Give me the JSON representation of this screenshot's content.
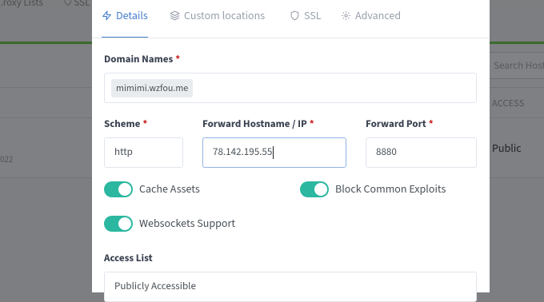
{
  "background": {
    "nav_items": [
      "...roxy Lists",
      "SSL"
    ],
    "search_placeholder": "Search Host",
    "access_header": "ACCESS",
    "public_value": "Public",
    "date_fragment": "022"
  },
  "tabs": [
    {
      "label": "Details",
      "icon": "lightning-icon",
      "active": true
    },
    {
      "label": "Custom locations",
      "icon": "layers-icon",
      "active": false
    },
    {
      "label": "SSL",
      "icon": "shield-icon",
      "active": false
    },
    {
      "label": "Advanced",
      "icon": "gear-icon",
      "active": false
    }
  ],
  "form": {
    "domain_names": {
      "label": "Domain Names",
      "required_mark": "*",
      "chip": "mimimi.wzfou.me"
    },
    "scheme": {
      "label": "Scheme",
      "required_mark": "*",
      "value": "http"
    },
    "forward_host": {
      "label": "Forward Hostname / IP",
      "required_mark": "*",
      "value": "78.142.195.55"
    },
    "forward_port": {
      "label": "Forward Port",
      "required_mark": "*",
      "value": "8880"
    },
    "cache_assets": {
      "label": "Cache Assets",
      "enabled": true
    },
    "block_exploits": {
      "label": "Block Common Exploits",
      "enabled": true
    },
    "websockets": {
      "label": "Websockets Support",
      "enabled": true
    },
    "access_list": {
      "label": "Access List",
      "value": "Publicly Accessible"
    }
  },
  "colors": {
    "accent": "#467fcf",
    "toggle_on": "#2bb7a0",
    "required": "#cd201f"
  }
}
